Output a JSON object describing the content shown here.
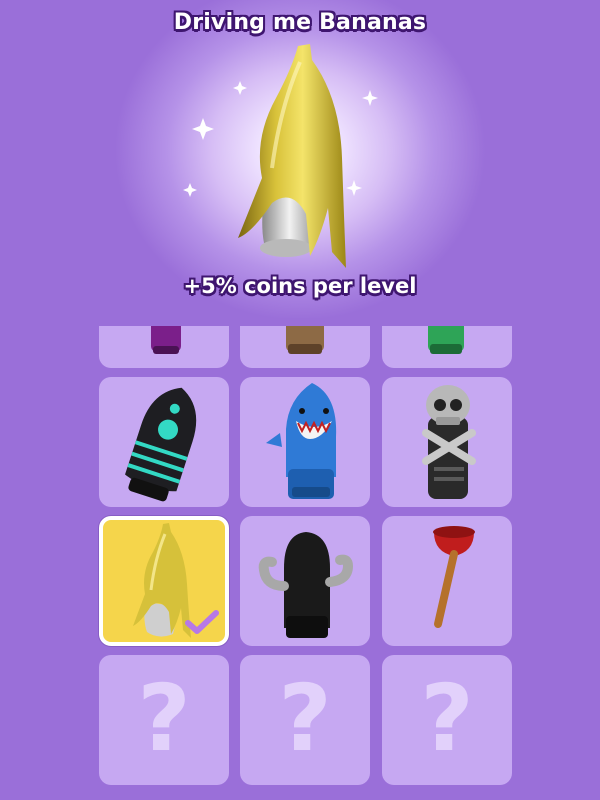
{
  "preview": {
    "title": "Driving me Bananas",
    "bonus": "+5% coins per level",
    "selected_skin": "banana-skin"
  },
  "colors": {
    "background": "#9a6fd9",
    "tile": "#c6a8f2",
    "tile_selected": "#f5d54b",
    "locked_glyph": "#e2d1fb",
    "check": "#b778e6",
    "text_outline": "#3f1670"
  },
  "grid": {
    "columns": 3,
    "rows": [
      [
        {
          "skin": "purple-skin",
          "state": "unlocked"
        },
        {
          "skin": "wooden-skin",
          "state": "unlocked"
        },
        {
          "skin": "green-skin",
          "state": "unlocked"
        }
      ],
      [
        {
          "skin": "neon-rocket-skin",
          "state": "unlocked"
        },
        {
          "skin": "shark-skin",
          "state": "unlocked"
        },
        {
          "skin": "skull-skin",
          "state": "unlocked"
        }
      ],
      [
        {
          "skin": "banana-skin",
          "state": "selected"
        },
        {
          "skin": "strongman-skin",
          "state": "unlocked"
        },
        {
          "skin": "plunger-skin",
          "state": "unlocked"
        }
      ],
      [
        {
          "skin": "locked-skin",
          "state": "locked",
          "glyph": "?"
        },
        {
          "skin": "locked-skin",
          "state": "locked",
          "glyph": "?"
        },
        {
          "skin": "locked-skin",
          "state": "locked",
          "glyph": "?"
        }
      ]
    ]
  }
}
